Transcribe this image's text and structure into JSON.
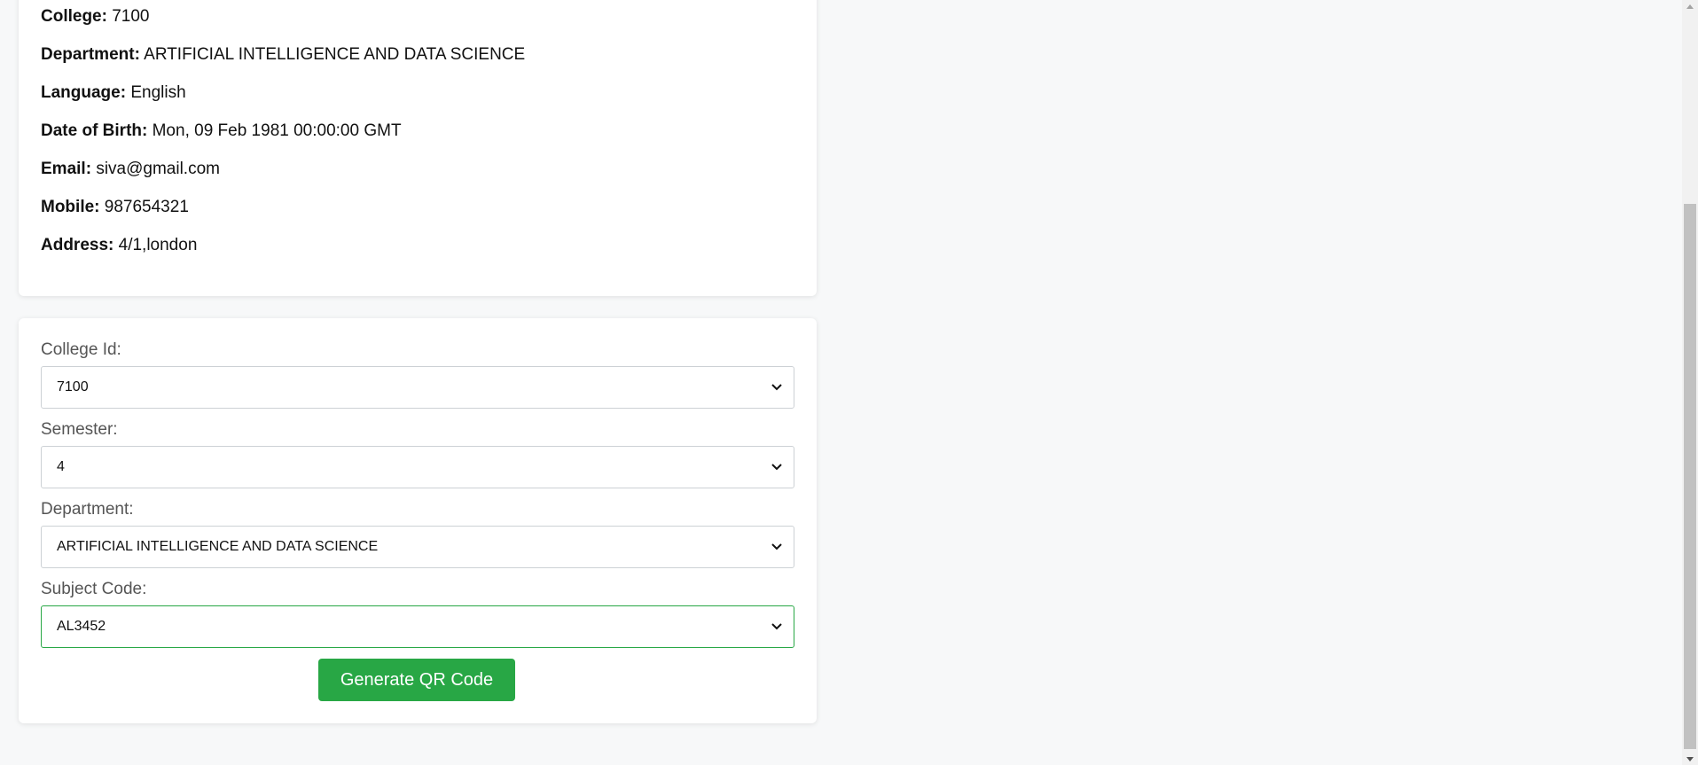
{
  "details": {
    "rows": [
      {
        "key": "College:",
        "value": "7100"
      },
      {
        "key": "Department:",
        "value": "ARTIFICIAL INTELLIGENCE AND DATA SCIENCE"
      },
      {
        "key": "Language:",
        "value": "English"
      },
      {
        "key": "Date of Birth:",
        "value": "Mon, 09 Feb 1981 00:00:00 GMT"
      },
      {
        "key": "Email:",
        "value": "siva@gmail.com"
      },
      {
        "key": "Mobile:",
        "value": "987654321"
      },
      {
        "key": "Address:",
        "value": "4/1,london"
      }
    ]
  },
  "form": {
    "college_id": {
      "label": "College Id:",
      "value": "7100"
    },
    "semester": {
      "label": "Semester:",
      "value": "4"
    },
    "department": {
      "label": "Department:",
      "value": "ARTIFICIAL INTELLIGENCE AND DATA SCIENCE"
    },
    "subject_code": {
      "label": "Subject Code:",
      "value": "AL3452"
    },
    "generate_button": "Generate QR Code"
  },
  "icons": {
    "select_chevron": "chevron-down-icon",
    "scroll_up": "scroll-up-arrow-icon",
    "scroll_down": "scroll-down-arrow-icon"
  },
  "colors": {
    "accent_green": "#28a745",
    "page_bg": "#f7f8f9"
  }
}
